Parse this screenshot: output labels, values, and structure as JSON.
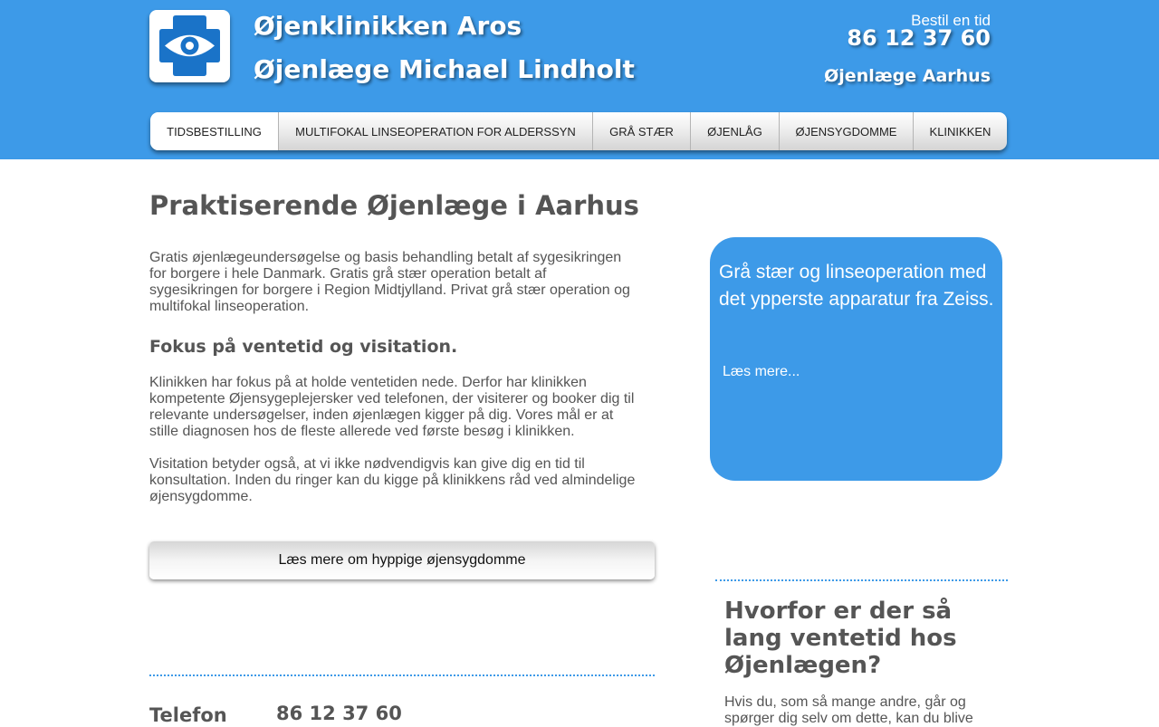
{
  "header": {
    "title": "Øjenklinikken Aros",
    "subtitle": "Øjenlæge Michael Lindholt",
    "book_label": "Bestil en tid",
    "phone": "86 12 37 60",
    "tagline": "Øjenlæge Aarhus",
    "logo_icon": "eye-cross-icon"
  },
  "nav": {
    "items": [
      {
        "label": "TIDSBESTILLING"
      },
      {
        "label": "MULTIFOKAL LINSEOPERATION FOR ALDERSSYN"
      },
      {
        "label": "GRÅ STÆR"
      },
      {
        "label": "ØJENLÅG"
      },
      {
        "label": "ØJENSYGDOMME"
      },
      {
        "label": "KLINIKKEN"
      }
    ]
  },
  "main": {
    "heading": "Praktiserende Øjenlæge i Aarhus",
    "intro": "Gratis øjenlægeundersøgelse og basis behandling betalt af sygesikringen for borgere i hele Danmark. Gratis grå stær operation betalt af sygesikringen for borgere i Region Midtjylland. Privat grå stær operation og multifokal linseoperation.",
    "subheading": "Fokus på ventetid og visitation.",
    "para1": "Klinikken har fokus på at holde ventetiden nede. Derfor har klinikken kompetente Øjensygeplejersker ved telefonen, der visiterer og booker dig til relevante undersøgelser, inden øjenlægen kigger på dig. Vores mål er at stille diagnosen hos de fleste allerede ved første besøg i klinikken.",
    "para2": "Visitation betyder også, at vi ikke nødvendigvis kan give dig en tid til konsultation. Inden du ringer kan du kigge på klinikkens råd ved almindelige øjensygdomme.",
    "button": "Læs mere om hyppige øjensygdomme",
    "phone_label": "Telefon",
    "phone": "86 12 37 60"
  },
  "sidebar": {
    "promo_text": "Grå stær og linseoperation med det ypperste apparatur fra Zeiss.",
    "promo_link": "Læs mere...",
    "heading": "Hvorfor er der så lang ventetid hos Øjenlægen?",
    "text": "Hvis du, som så mange andre, går og spørger dig selv om dette, kan du blive"
  },
  "colors": {
    "brand_blue": "#3d9ae8",
    "text_gray": "#555555"
  }
}
